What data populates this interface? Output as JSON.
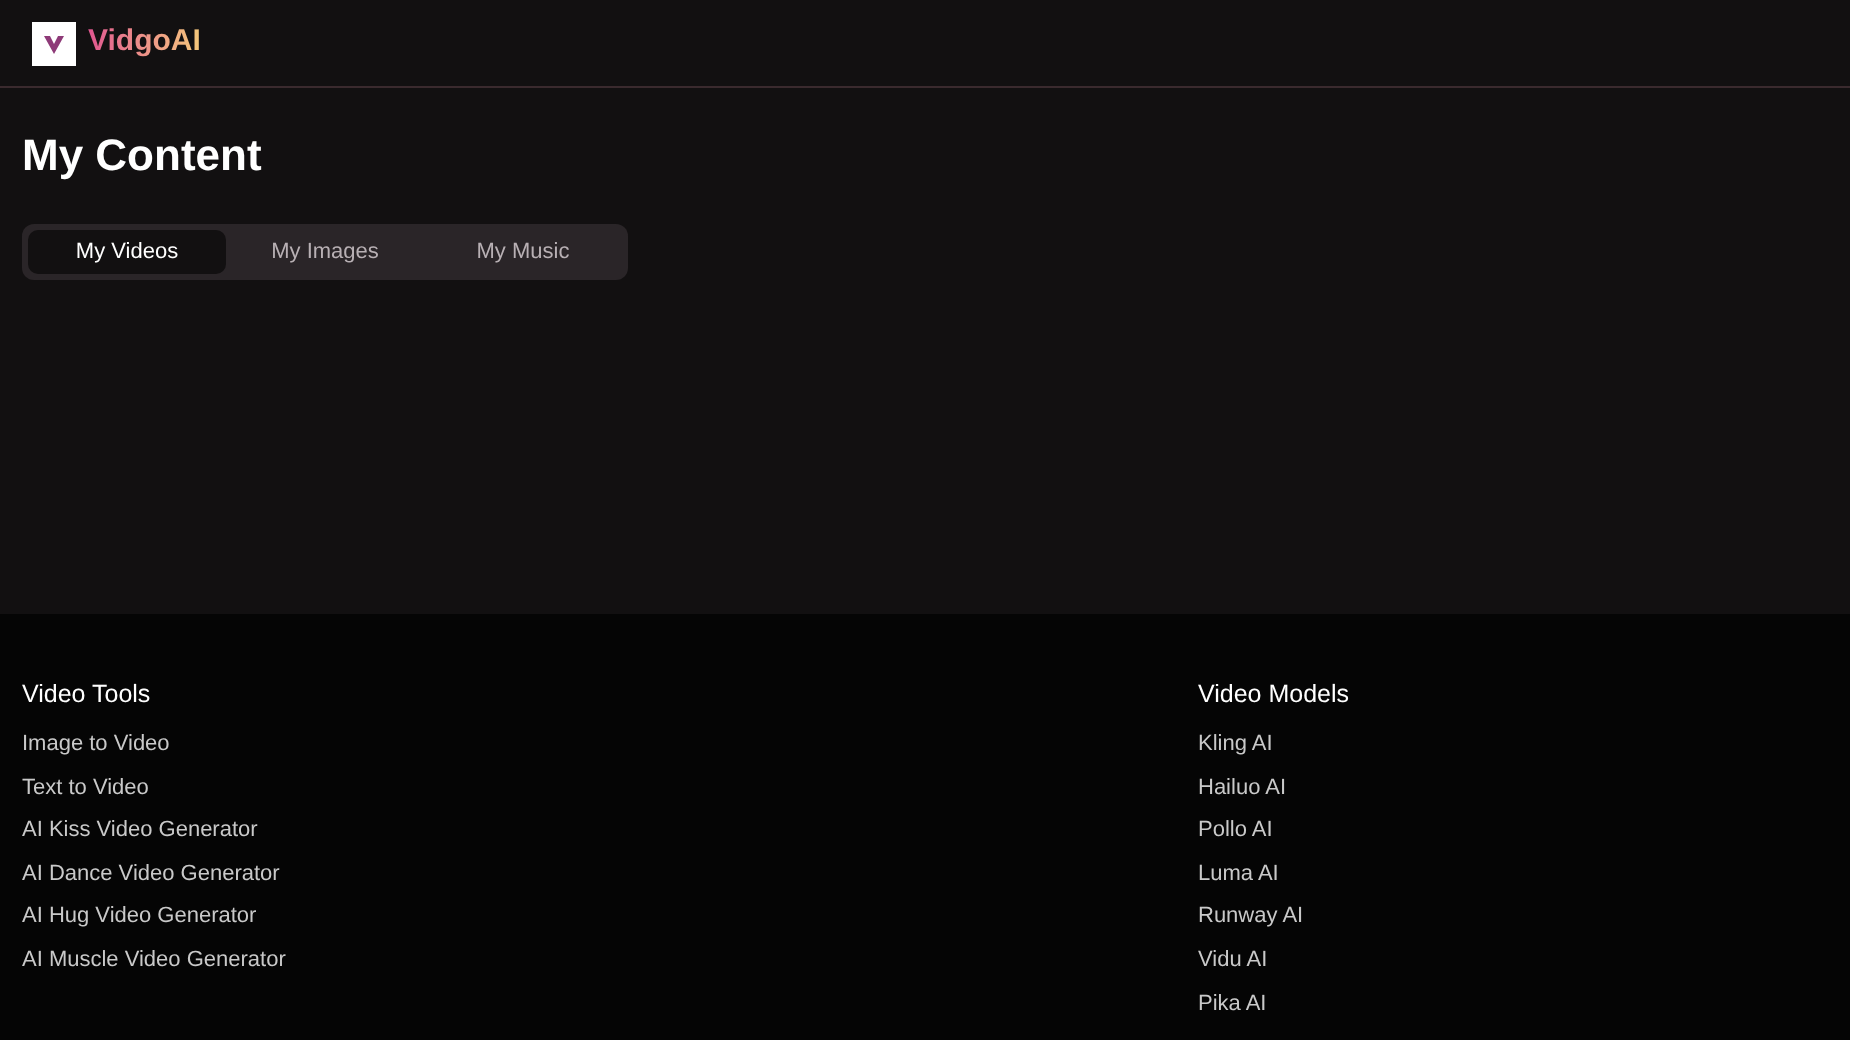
{
  "brand": {
    "name": "VidgoAI"
  },
  "page_title": "My Content",
  "tabs": [
    {
      "label": "My Videos",
      "selected": true
    },
    {
      "label": "My Images",
      "selected": false
    },
    {
      "label": "My Music",
      "selected": false
    }
  ],
  "footer": {
    "columns": [
      {
        "title": "Video Tools",
        "links": [
          "Image to Video",
          "Text to Video",
          "AI Kiss Video Generator",
          "AI Dance Video Generator",
          "AI Hug Video Generator",
          "AI Muscle Video Generator"
        ]
      },
      {
        "title": "Video Models",
        "links": [
          "Kling AI",
          "Hailuo AI",
          "Pollo AI",
          "Luma AI",
          "Runway AI",
          "Vidu AI",
          "Pika AI"
        ]
      }
    ]
  }
}
